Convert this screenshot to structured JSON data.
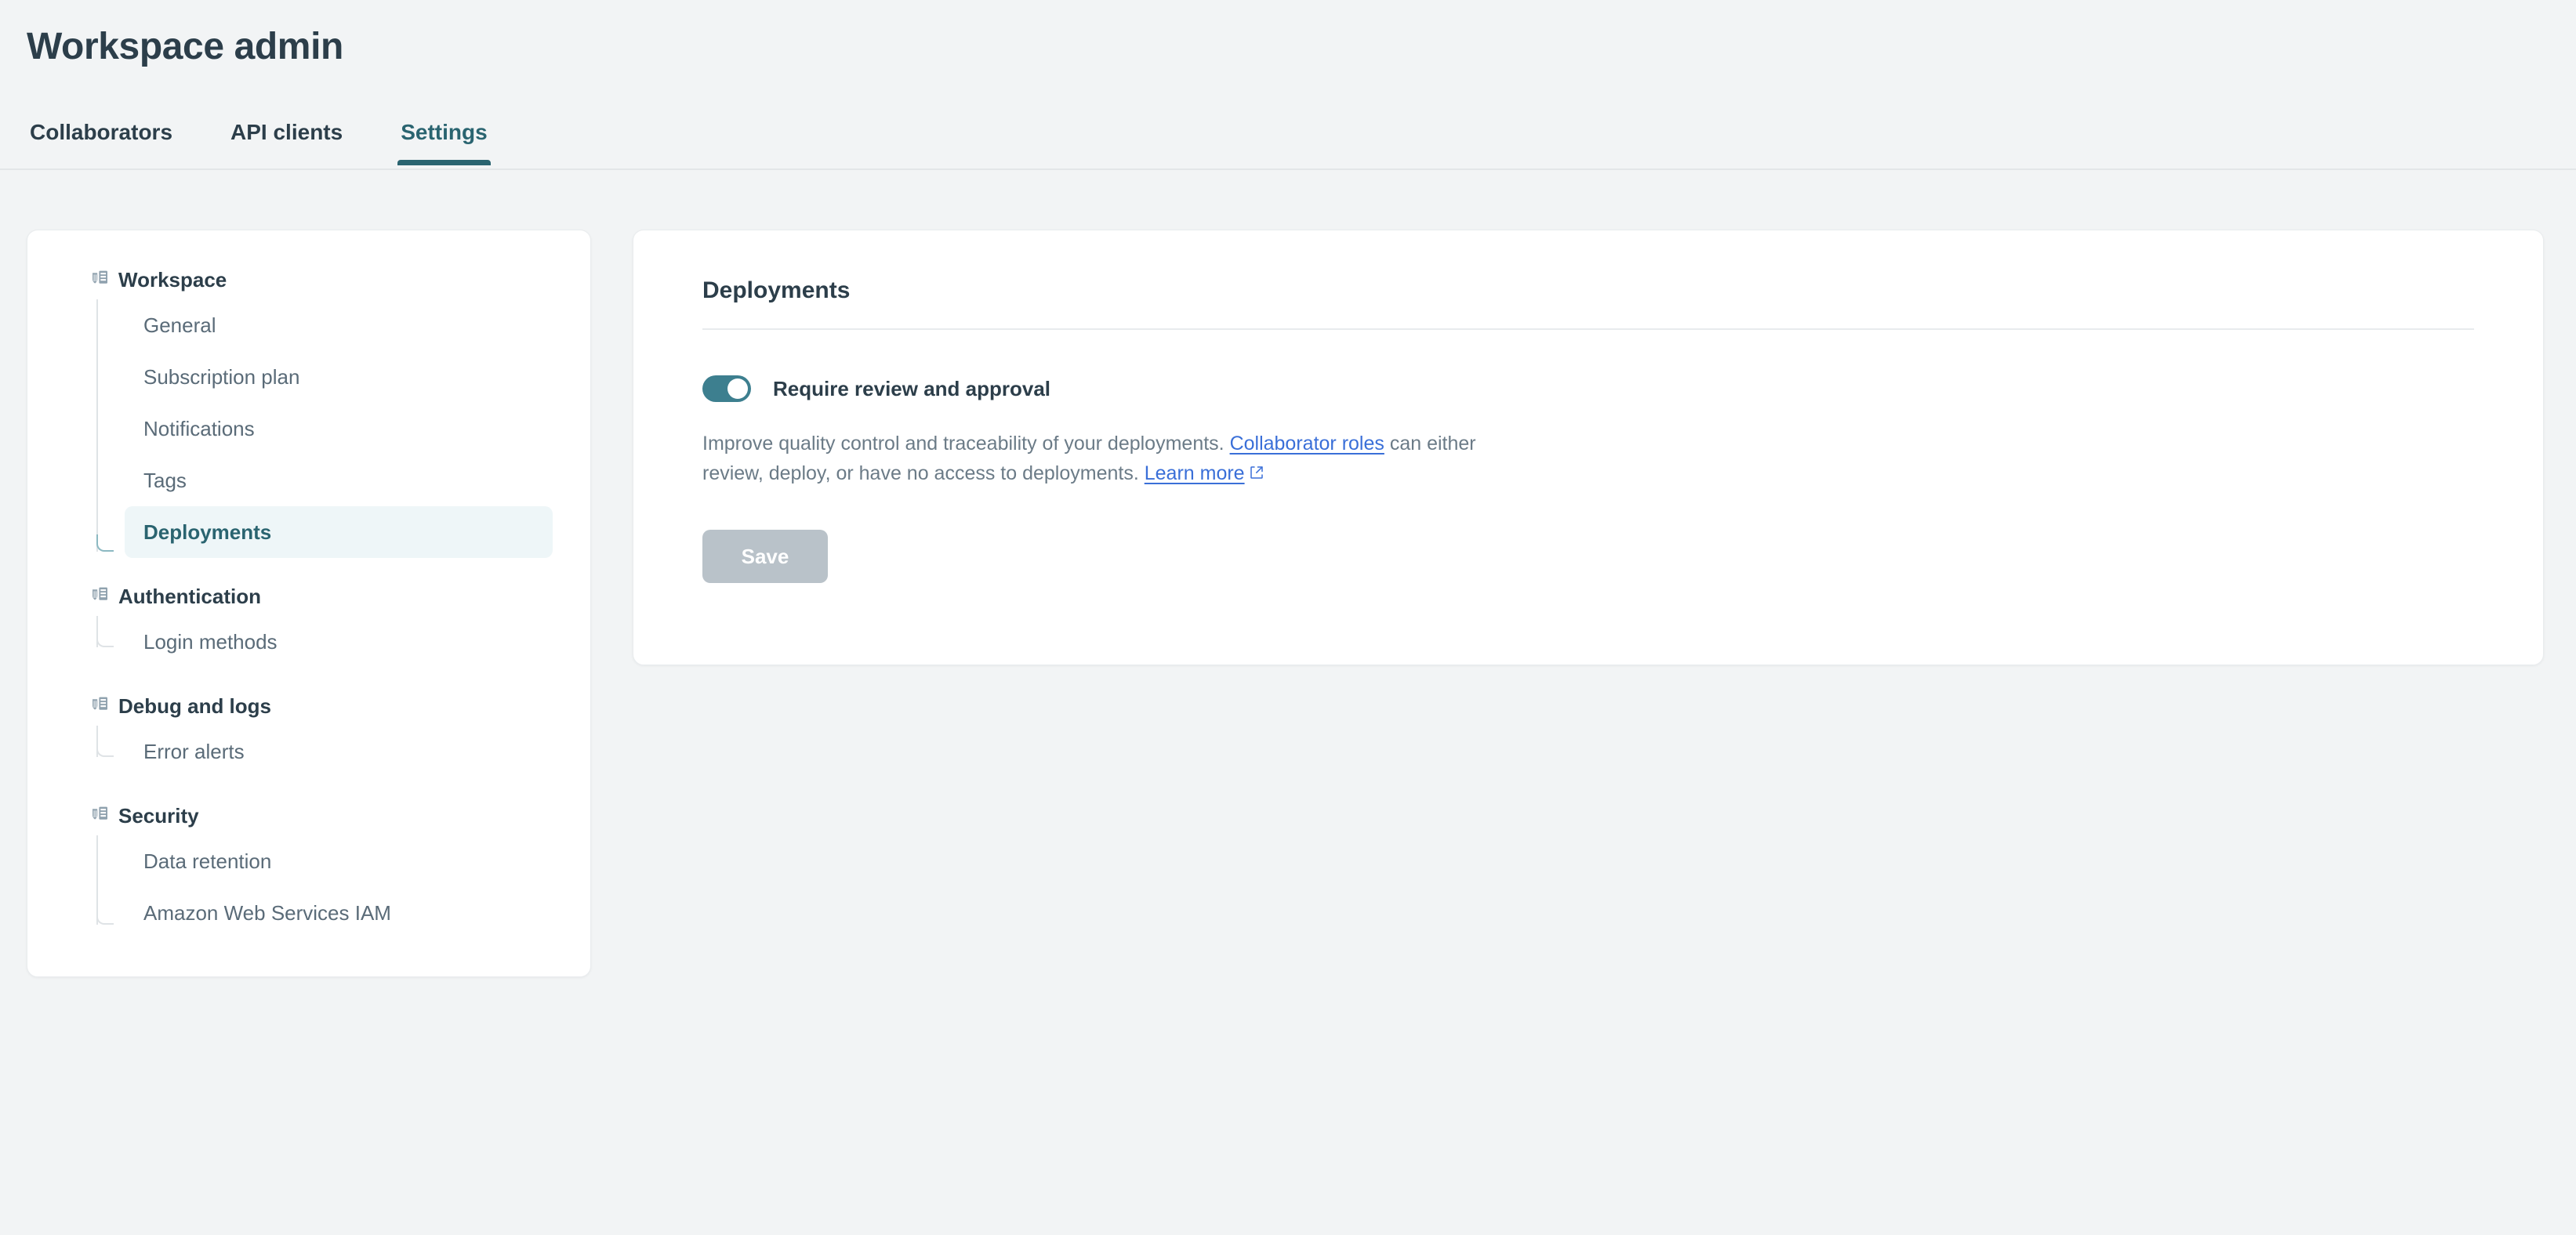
{
  "header": {
    "title": "Workspace admin",
    "tabs": [
      {
        "label": "Collaborators",
        "active": false
      },
      {
        "label": "API clients",
        "active": false
      },
      {
        "label": "Settings",
        "active": true
      }
    ]
  },
  "sidebar": {
    "groups": [
      {
        "label": "Workspace",
        "icon": "shield-server-icon",
        "items": [
          {
            "label": "General",
            "active": false
          },
          {
            "label": "Subscription plan",
            "active": false
          },
          {
            "label": "Notifications",
            "active": false
          },
          {
            "label": "Tags",
            "active": false
          },
          {
            "label": "Deployments",
            "active": true
          }
        ]
      },
      {
        "label": "Authentication",
        "icon": "shield-server-icon",
        "items": [
          {
            "label": "Login methods",
            "active": false
          }
        ]
      },
      {
        "label": "Debug and logs",
        "icon": "shield-server-icon",
        "items": [
          {
            "label": "Error alerts",
            "active": false
          }
        ]
      },
      {
        "label": "Security",
        "icon": "shield-server-icon",
        "items": [
          {
            "label": "Data retention",
            "active": false
          },
          {
            "label": "Amazon Web Services IAM",
            "active": false
          }
        ]
      }
    ]
  },
  "main": {
    "section_title": "Deployments",
    "toggle": {
      "label": "Require review and approval",
      "checked": true
    },
    "helper": {
      "part1": "Improve quality control and traceability of your deployments. ",
      "link1": "Collaborator roles",
      "part2": " can either review, deploy, or have no access to deployments. ",
      "link2": "Learn more",
      "link2_icon": "external-link-icon"
    },
    "save_label": "Save",
    "save_disabled": true
  },
  "colors": {
    "page_background": "#f2f4f5",
    "card_background": "#ffffff",
    "accent_teal": "#2a6470",
    "toggle_on": "#3d7f8f",
    "active_item_background": "#eef6f8",
    "link_blue": "#3a6fd8",
    "text_primary": "#2c3e4a",
    "text_muted": "#6b7b87",
    "save_disabled_background": "#b9c2c9"
  }
}
